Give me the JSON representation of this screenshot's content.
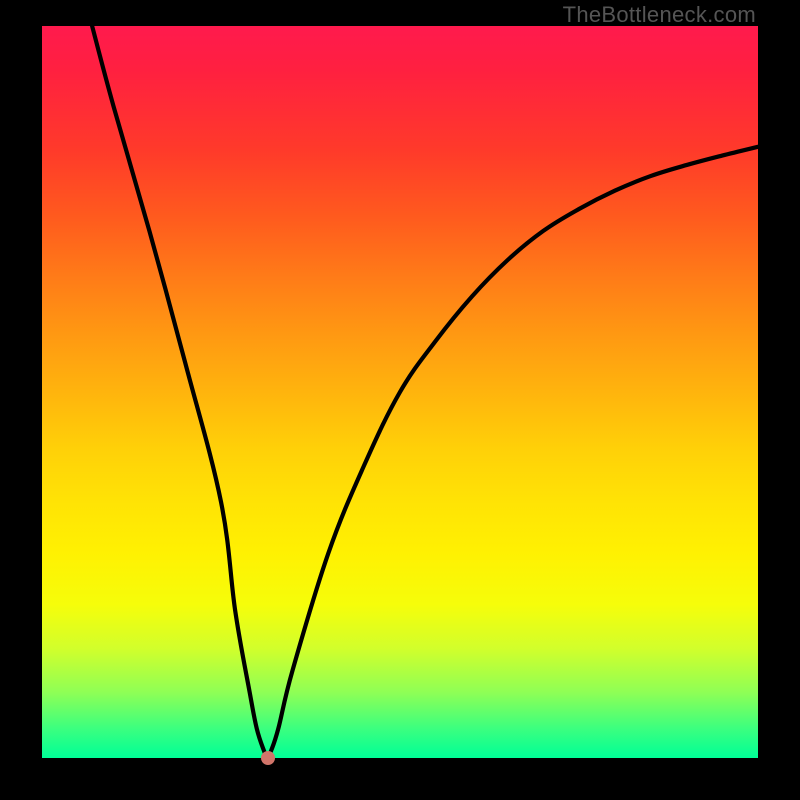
{
  "watermark": "TheBottleneck.com",
  "chart_data": {
    "type": "line",
    "title": "",
    "xlabel": "",
    "ylabel": "",
    "xlim": [
      0,
      100
    ],
    "ylim": [
      0,
      100
    ],
    "grid": false,
    "legend": false,
    "series": [
      {
        "name": "bottleneck-curve",
        "x": [
          7,
          10,
          15,
          20,
          25,
          27,
          29,
          30,
          31,
          31.5,
          32,
          33,
          35,
          40,
          45,
          50,
          55,
          60,
          65,
          70,
          75,
          80,
          85,
          90,
          95,
          100
        ],
        "values": [
          100,
          89,
          72,
          54,
          35,
          20,
          9,
          4,
          1,
          0,
          1,
          4,
          12,
          28,
          40,
          50,
          57,
          63,
          68,
          72,
          75,
          77.5,
          79.5,
          81,
          82.3,
          83.5
        ]
      }
    ],
    "marker": {
      "x": 31.5,
      "y": 0,
      "color": "#d1756a"
    },
    "background_gradient": {
      "direction": "top-to-bottom",
      "stops": [
        {
          "pos": 0.0,
          "color": "#ff1a4d"
        },
        {
          "pos": 0.5,
          "color": "#ffb40d"
        },
        {
          "pos": 0.75,
          "color": "#fff102"
        },
        {
          "pos": 1.0,
          "color": "#00ff97"
        }
      ]
    }
  }
}
